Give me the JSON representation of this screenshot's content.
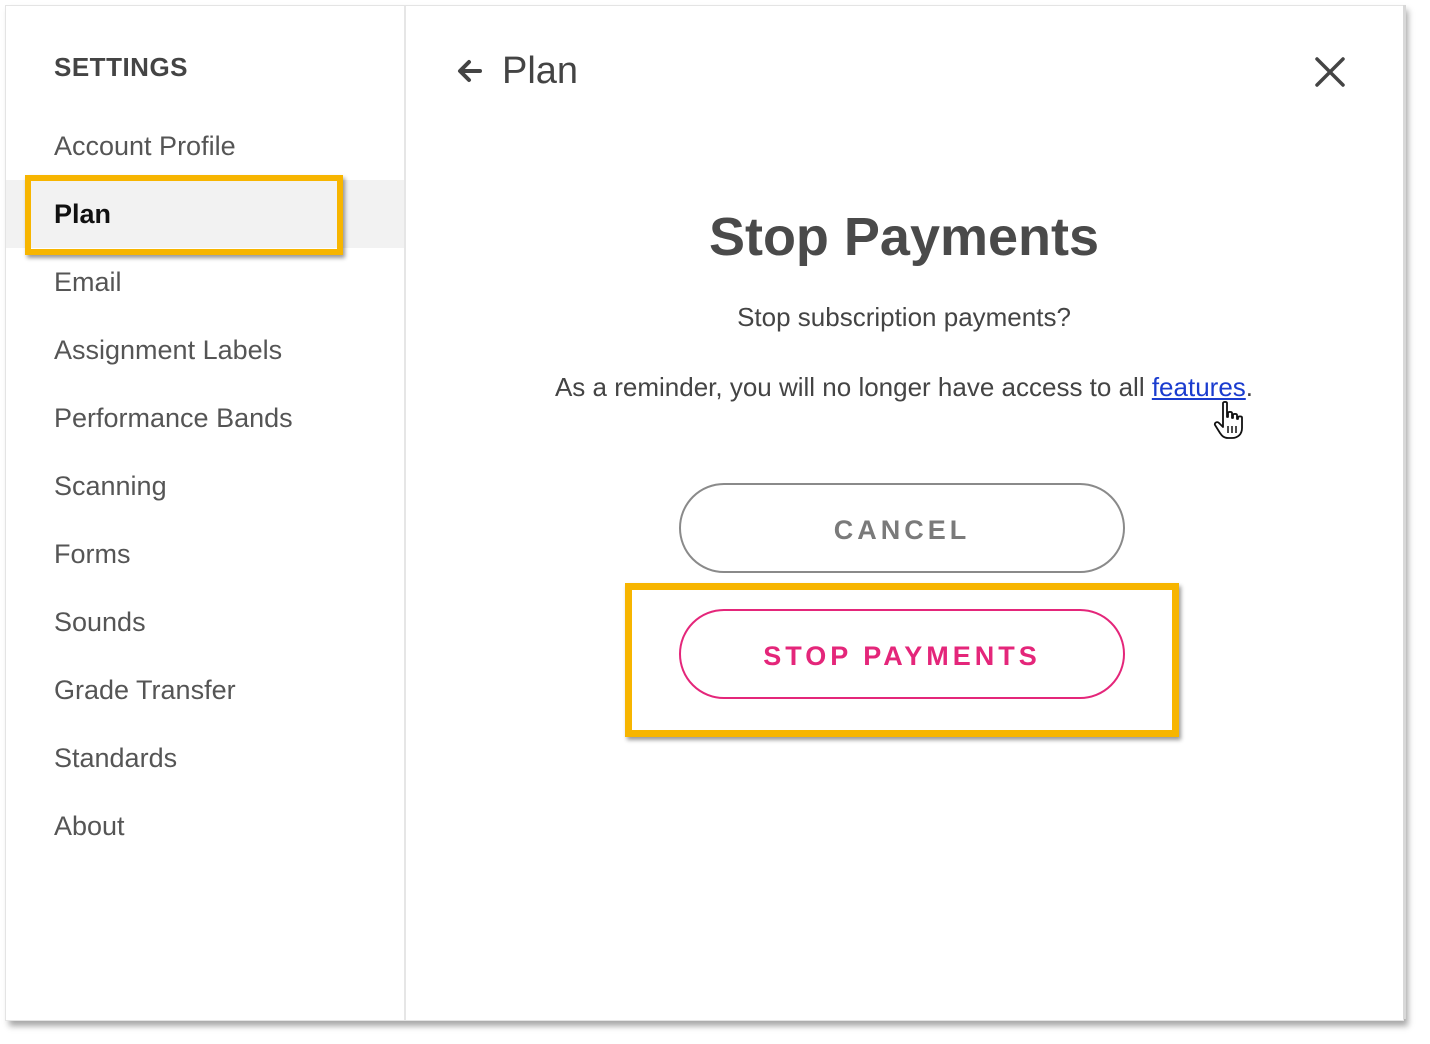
{
  "sidebar": {
    "title": "SETTINGS",
    "items": [
      {
        "label": "Account Profile"
      },
      {
        "label": "Plan",
        "active": true
      },
      {
        "label": "Email"
      },
      {
        "label": "Assignment Labels"
      },
      {
        "label": "Performance Bands"
      },
      {
        "label": "Scanning"
      },
      {
        "label": "Forms"
      },
      {
        "label": "Sounds"
      },
      {
        "label": "Grade Transfer"
      },
      {
        "label": "Standards"
      },
      {
        "label": "About"
      }
    ]
  },
  "header": {
    "title": "Plan",
    "back_icon": "arrow-left-icon",
    "close_icon": "close-icon"
  },
  "dialog": {
    "title": "Stop Payments",
    "question": "Stop subscription payments?",
    "reminder_prefix": "As a reminder, you will no longer have access to all ",
    "reminder_link": "features",
    "reminder_suffix": ".",
    "cancel_label": "CANCEL",
    "stop_label": "STOP PAYMENTS"
  },
  "colors": {
    "accent_pink": "#e4267a",
    "highlight": "#f7b500",
    "link": "#1a3ccf"
  }
}
